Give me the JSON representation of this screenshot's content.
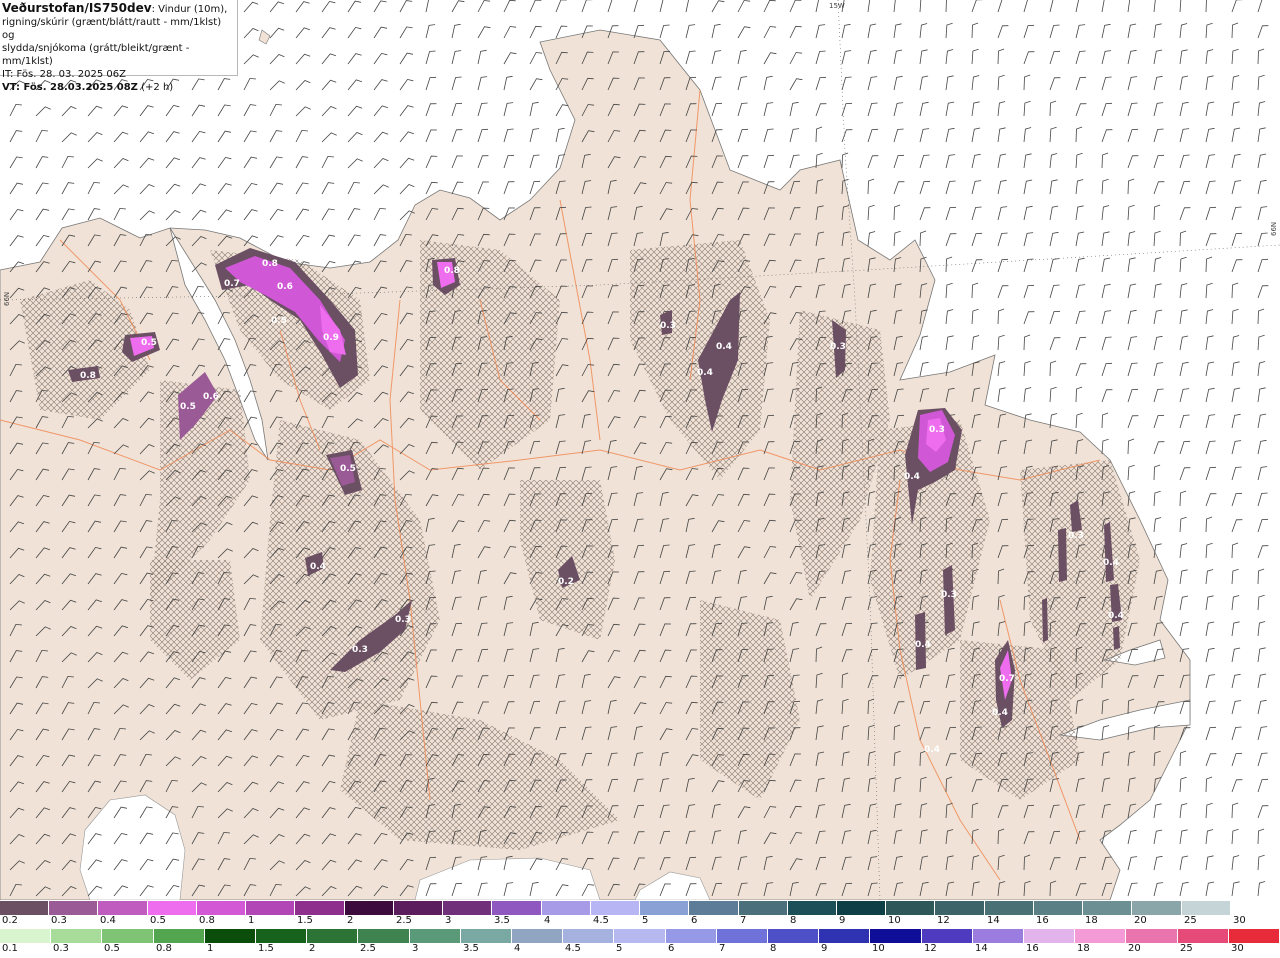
{
  "info": {
    "source": "Veðurstofan/IS750dev",
    "desc1": ": Vindur (10m),",
    "desc2": "rigning/skúrir (grænt/blátt/rautt - mm/1klst) og",
    "desc3": "slydda/snjókoma (grátt/bleikt/grænt - mm/1klst)",
    "it": "IT: Fös. 28. 03. 2025 06Z",
    "vt": "VT: Fös. 28.03.2025 08Z",
    "vt_offset": " (+2 h)"
  },
  "grid_labels": {
    "top": "15W",
    "left": "66N",
    "right": "66N"
  },
  "map_labels": [
    "0.8",
    "0.7",
    "0.6",
    "0.5",
    "0.9",
    "0.8",
    "0.5",
    "0.8",
    "0.5",
    "0.6",
    "0.5",
    "0.8",
    "0.4",
    "0.3",
    "0.3",
    "0.3",
    "0.4",
    "0.4",
    "0.3",
    "0.2",
    "0.3",
    "0.4",
    "0.3",
    "0.3",
    "0.4",
    "0.7",
    "0.4",
    "0.4",
    "0.4",
    "0.4"
  ],
  "legend_snow": {
    "labels": [
      "0.2",
      "0.3",
      "0.4",
      "0.5",
      "0.8",
      "1",
      "1.5",
      "2",
      "2.5",
      "3",
      "3.5",
      "4",
      "4.5",
      "5",
      "6",
      "7",
      "8",
      "9",
      "10",
      "12",
      "14",
      "16",
      "18",
      "20",
      "25",
      "30"
    ],
    "colors": [
      "#6b4f63",
      "#9a5a96",
      "#c05bc0",
      "#ee6cee",
      "#d258d6",
      "#b246b6",
      "#8e2f8e",
      "#3c0a3c",
      "#5c1d5e",
      "#71307a",
      "#8f58c0",
      "#a79ae6",
      "#b7b5f3",
      "#8aa1d6",
      "#5c7c97",
      "#4c6f7c",
      "#1d4f58",
      "#0e3e46",
      "#2d5759",
      "#3c6367",
      "#497074",
      "#5a7f84",
      "#6c8f94",
      "#8aa6a9",
      "#c5d4d6",
      "#ffffff"
    ]
  },
  "legend_rain": {
    "labels": [
      "0.1",
      "0.3",
      "0.5",
      "0.8",
      "1",
      "1.5",
      "2",
      "2.5",
      "3",
      "3.5",
      "4",
      "4.5",
      "5",
      "6",
      "7",
      "8",
      "9",
      "10",
      "12",
      "14",
      "16",
      "18",
      "20",
      "25",
      "30"
    ],
    "colors": [
      "#d8f5d0",
      "#a8dc9a",
      "#7ec474",
      "#54a550",
      "#0b4d0b",
      "#17621d",
      "#2b7435",
      "#3f8450",
      "#5a9a78",
      "#7aa9a3",
      "#8fa5c1",
      "#a5b1de",
      "#b6b9f0",
      "#9599e6",
      "#6f72d8",
      "#4d50c6",
      "#2f33b1",
      "#0e0e99",
      "#4f3bc0",
      "#9a7ddf",
      "#e3b3ec",
      "#f49ad6",
      "#ea74ad",
      "#e54a78",
      "#e82b3a"
    ]
  }
}
